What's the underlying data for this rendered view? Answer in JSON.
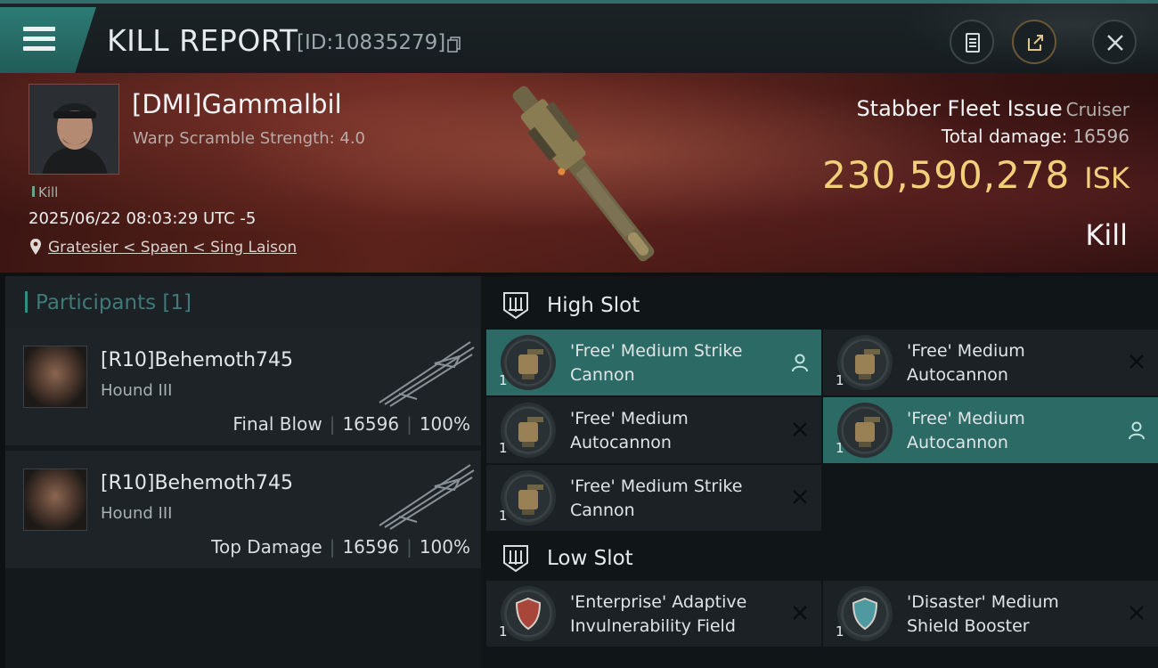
{
  "header": {
    "title": "KILL REPORT",
    "report_id": "[ID:10835279]",
    "icons": {
      "menu": "menu-icon",
      "copy": "copy-icon",
      "clipboard": "clipboard-icon",
      "share": "share-icon",
      "close": "close-icon"
    }
  },
  "victim": {
    "name": "[DMI]Gammalbil",
    "warp_scramble": "Warp Scramble Strength: 4.0",
    "tag": "Kill",
    "timestamp": "2025/06/22 08:03:29 UTC -5",
    "location": "Gratesier < Spaen < Sing Laison",
    "ship_name": "Stabber Fleet Issue",
    "ship_class": "Cruiser",
    "total_damage_label": "Total damage:",
    "total_damage_value": "16596",
    "isk_value": "230,590,278",
    "isk_unit": "ISK",
    "result": "Kill"
  },
  "participants": {
    "label": "Participants",
    "count": "[1]",
    "items": [
      {
        "name": "[R10]Behemoth745",
        "ship": "Hound III",
        "role": "Final Blow",
        "damage": "16596",
        "percent": "100%"
      },
      {
        "name": "[R10]Behemoth745",
        "ship": "Hound III",
        "role": "Top Damage",
        "damage": "16596",
        "percent": "100%"
      }
    ]
  },
  "fitting": {
    "high_slot": {
      "label": "High Slot",
      "modules": [
        {
          "name": "'Free' Medium Strike Cannon",
          "qty": "1",
          "state": "fitted",
          "selected": true
        },
        {
          "name": "'Free' Medium Autocannon",
          "qty": "1",
          "state": "destroyed",
          "selected": false
        },
        {
          "name": "'Free' Medium Autocannon",
          "qty": "1",
          "state": "destroyed",
          "selected": false
        },
        {
          "name": "'Free' Medium Autocannon",
          "qty": "1",
          "state": "fitted",
          "selected": true
        },
        {
          "name": "'Free' Medium Strike Cannon",
          "qty": "1",
          "state": "destroyed",
          "selected": false
        }
      ]
    },
    "low_slot": {
      "label": "Low Slot",
      "modules": [
        {
          "name": "'Enterprise' Adaptive Invulnerability Field",
          "qty": "1",
          "state": "destroyed",
          "selected": false
        },
        {
          "name": "'Disaster' Medium Shield Booster",
          "qty": "1",
          "state": "destroyed",
          "selected": false
        }
      ]
    }
  },
  "colors": {
    "accent": "#2c6a66",
    "isk": "#f2cf7a",
    "banner": "#5a221a"
  }
}
